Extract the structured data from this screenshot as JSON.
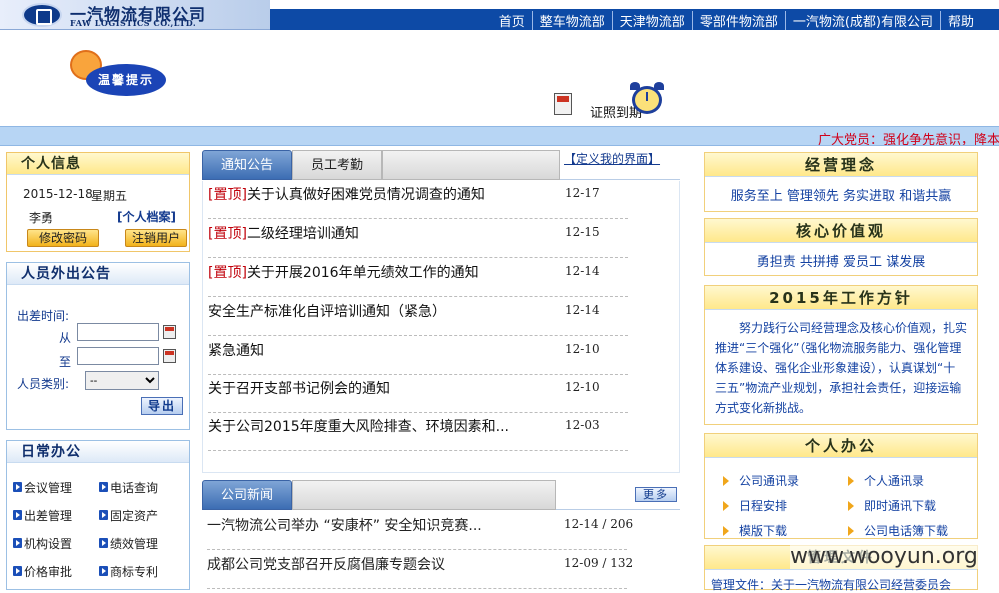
{
  "header": {
    "logo_cn": "一汽物流有限公司",
    "logo_en": "FAW LOGISTICS CO.,LTD.",
    "nav": [
      "首页",
      "整车物流部",
      "天津物流部",
      "零部件物流部",
      "一汽物流(成都)有限公司",
      "帮助"
    ]
  },
  "banner": {
    "tip": "温馨提示",
    "cert_text": "证照到期",
    "ticker": "广大党员：强化争先意识，降本增"
  },
  "info": {
    "title": "个人信息",
    "date": "2015-12-18",
    "weekday": "星期五",
    "name": "李勇",
    "archive": "[个人档案]",
    "change_pwd": "修改密码",
    "logout": "注销用户"
  },
  "out": {
    "title": "人员外出公告",
    "trip_time": "出差时间:",
    "from": "从",
    "to": "至",
    "type": "人员类别:",
    "type_value": "--",
    "export": "导出"
  },
  "daily": {
    "title": "日常办公",
    "items": [
      "会议管理",
      "电话查询",
      "出差管理",
      "固定资产",
      "机构设置",
      "绩效管理",
      "价格审批",
      "商标专利"
    ]
  },
  "tabs": {
    "notice": "通知公告",
    "attendance": "员工考勤",
    "custom": "【定义我的界面】",
    "more": "更多"
  },
  "notices": [
    {
      "top": "[置顶]",
      "title": "关于认真做好困难党员情况调查的通知",
      "date": "12-17"
    },
    {
      "top": "[置顶]",
      "title": "二级经理培训通知",
      "date": "12-15"
    },
    {
      "top": "[置顶]",
      "title": "关于开展2016年单元绩效工作的通知",
      "date": "12-14"
    },
    {
      "top": "",
      "title": "安全生产标准化自评培训通知（紧急）",
      "date": "12-14"
    },
    {
      "top": "",
      "title": "紧急通知",
      "date": "12-10"
    },
    {
      "top": "",
      "title": "关于召开支部书记例会的通知",
      "date": "12-10"
    },
    {
      "top": "",
      "title": "关于公司2015年度重大风险排查、环境因素和...",
      "date": "12-03"
    }
  ],
  "news": {
    "tab": "公司新闻",
    "items": [
      {
        "title": "一汽物流公司举办 “安康杯” 安全知识竞赛...",
        "date": "12-14 / 206"
      },
      {
        "title": "成都公司党支部召开反腐倡廉专题会议",
        "date": "12-09 / 132"
      }
    ]
  },
  "right": {
    "philosophy": {
      "title": "经营理念",
      "text": "服务至上 管理领先 务实进取 和谐共赢"
    },
    "values": {
      "title": "核心价值观",
      "text": "勇担责 共拼搏 爱员工 谋发展"
    },
    "policy": {
      "title": "2015年工作方针",
      "text": "努力践行公司经营理念及核心价值观，扎实推进“三个强化”（强化物流服务能力、强化管理体系建设、强化企业形象建设），认真谋划“十三五”物流产业规划，承担社会责任，迎接运输方式变化新挑战。"
    },
    "office": {
      "title": "个人办公",
      "items": [
        "公司通讯录",
        "个人通讯录",
        "日程安排",
        "即时通讯下载",
        "模版下载",
        "公司电话簿下载"
      ]
    },
    "docs": {
      "title": "管理文件",
      "line": "管理文件：关于一汽物流有限公司经营委员会"
    }
  },
  "watermark": "www.wooyun.org"
}
